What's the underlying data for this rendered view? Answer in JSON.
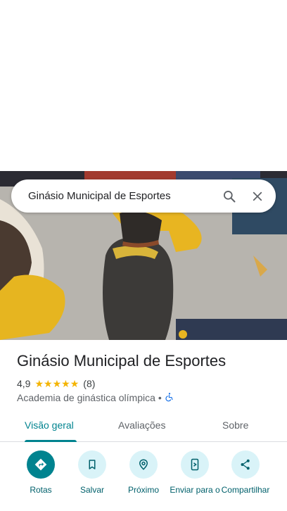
{
  "search": {
    "query": "Ginásio Municipal de Esportes",
    "search_icon": "search-icon",
    "close_icon": "close-icon"
  },
  "photo": {
    "description_icon": "place-photo"
  },
  "place": {
    "name": "Ginásio Municipal de Esportes",
    "rating": "4,9",
    "stars": 5,
    "review_count": "(8)",
    "category": "Academia de ginástica olímpica",
    "separator": "•",
    "accessibility_icon": "wheelchair-icon"
  },
  "tabs": [
    {
      "label": "Visão geral",
      "active": true
    },
    {
      "label": "Avaliações",
      "active": false
    },
    {
      "label": "Sobre",
      "active": false
    }
  ],
  "actions": [
    {
      "label": "Rotas",
      "icon": "directions-icon",
      "primary": true
    },
    {
      "label": "Salvar",
      "icon": "bookmark-icon",
      "primary": false
    },
    {
      "label": "Próximo",
      "icon": "nearby-icon",
      "primary": false
    },
    {
      "label": "Enviar para o",
      "icon": "send-to-phone-icon",
      "primary": false
    },
    {
      "label": "Compartilhar",
      "icon": "share-icon",
      "primary": false
    }
  ],
  "colors": {
    "accent": "#00838f",
    "star": "#f4b400",
    "action_bg": "#d9f3f8"
  }
}
